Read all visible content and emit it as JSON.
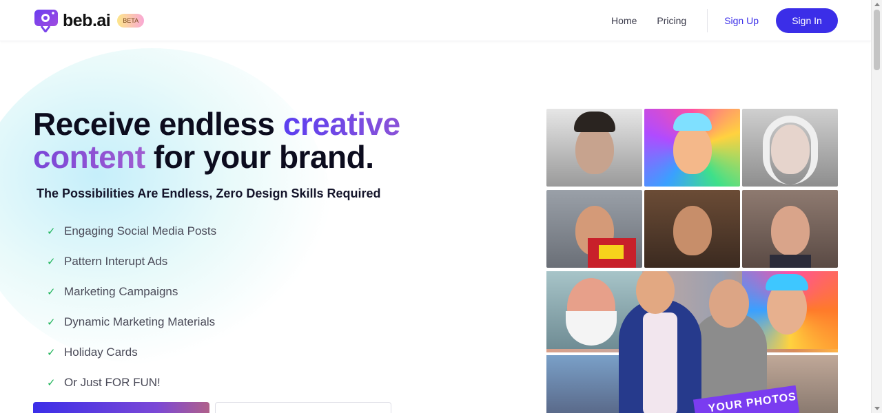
{
  "header": {
    "brand": "beb.ai",
    "badge": "BETA",
    "nav": [
      "Home",
      "Pricing"
    ],
    "signup_label": "Sign Up",
    "signin_label": "Sign In"
  },
  "hero": {
    "headline": {
      "part1": "Receive endless ",
      "accent1": "creative",
      "accent2": "content",
      "part2": " for your brand."
    },
    "subtitle": "The Possibilities Are Endless, Zero Design Skills Required",
    "check_glyph": "✓",
    "features": [
      "Engaging Social Media Posts",
      "Pattern Interupt Ads",
      "Marketing Campaigns",
      "Dynamic Marketing Materials",
      "Holiday Cards",
      "Or Just FOR FUN!"
    ]
  },
  "gallery": {
    "banner_text": "YOUR PHOTOS"
  },
  "colors": {
    "brand": "#3b2ee8",
    "accent_purple": "#8a52d8",
    "check_green": "#1fb45a"
  }
}
